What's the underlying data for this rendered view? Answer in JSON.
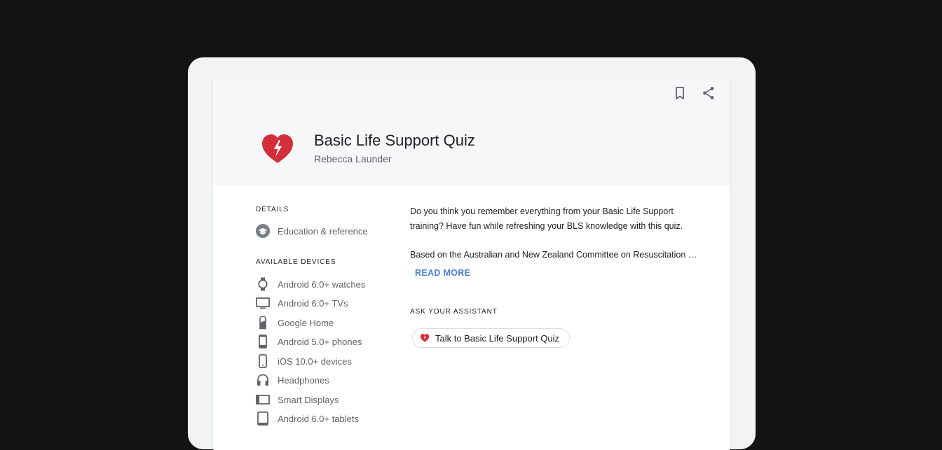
{
  "app": {
    "title": "Basic Life Support Quiz",
    "author": "Rebecca Launder",
    "icon": "broken-heart-icon",
    "accent": "#d32f3a"
  },
  "details": {
    "label": "DETAILS",
    "category": {
      "icon": "education-icon",
      "text": "Education & reference"
    }
  },
  "devices": {
    "label": "AVAILABLE DEVICES",
    "items": [
      {
        "icon": "watch-icon",
        "text": "Android 6.0+ watches"
      },
      {
        "icon": "tv-icon",
        "text": "Android 6.0+ TVs"
      },
      {
        "icon": "google-home-icon",
        "text": "Google Home"
      },
      {
        "icon": "phone-icon",
        "text": "Android 5.0+ phones"
      },
      {
        "icon": "ios-phone-icon",
        "text": "iOS 10.0+ devices"
      },
      {
        "icon": "headphones-icon",
        "text": "Headphones"
      },
      {
        "icon": "smart-display-icon",
        "text": "Smart Displays"
      },
      {
        "icon": "tablet-icon",
        "text": "Android 6.0+ tablets"
      }
    ]
  },
  "description": {
    "line1": "Do you think you remember everything from your Basic Life Support",
    "line2": "training? Have fun while refreshing your BLS knowledge with this quiz.",
    "line3": "Based on the Australian and New Zealand Committee on Resuscitation …",
    "read_more": "READ MORE"
  },
  "assistant": {
    "label": "ASK YOUR ASSISTANT",
    "chip": "Talk to Basic Life Support Quiz"
  },
  "colors": {
    "link": "#4a80d6",
    "icon_grey": "#5f6368"
  }
}
